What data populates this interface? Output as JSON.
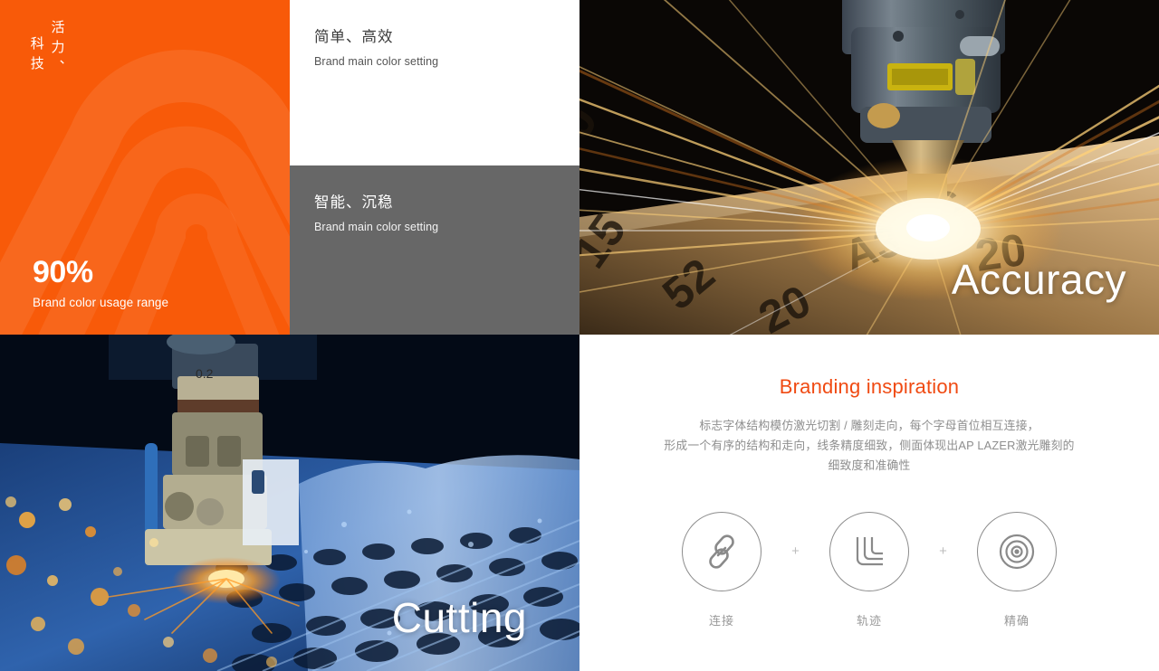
{
  "brand": {
    "accent_color": "#f85a09",
    "vertical_title_col1": "活力、",
    "vertical_title_col2": "科技",
    "stat_value": "90%",
    "stat_label": "Brand color usage range"
  },
  "swatches": [
    {
      "title": "简单、高效",
      "subtitle": "Brand main color setting",
      "swatch_color": "#ffffff"
    },
    {
      "title": "智能、沉稳",
      "subtitle": "Brand main color setting",
      "swatch_color": "#676767"
    }
  ],
  "photos": {
    "accuracy": {
      "caption": "Accuracy",
      "alt": "laser-cutting-head-sparks"
    },
    "cutting": {
      "caption": "Cutting",
      "alt": "cnc-laser-cutting-blue"
    }
  },
  "inspiration": {
    "title": "Branding inspiration",
    "title_color": "#f04a12",
    "paragraph_lines": [
      "标志字体结构模仿激光切割 / 雕刻走向，每个字母首位相互连接，",
      "形成一个有序的结构和走向，线条精度细致，侧面体现出AP LAZER激光雕刻的",
      "细致度和准确性"
    ],
    "separator": "+",
    "icons": [
      {
        "label": "连接",
        "icon": "chain-link-icon"
      },
      {
        "label": "轨迹",
        "icon": "nested-corner-path-icon"
      },
      {
        "label": "精确",
        "icon": "concentric-target-icon"
      }
    ]
  }
}
